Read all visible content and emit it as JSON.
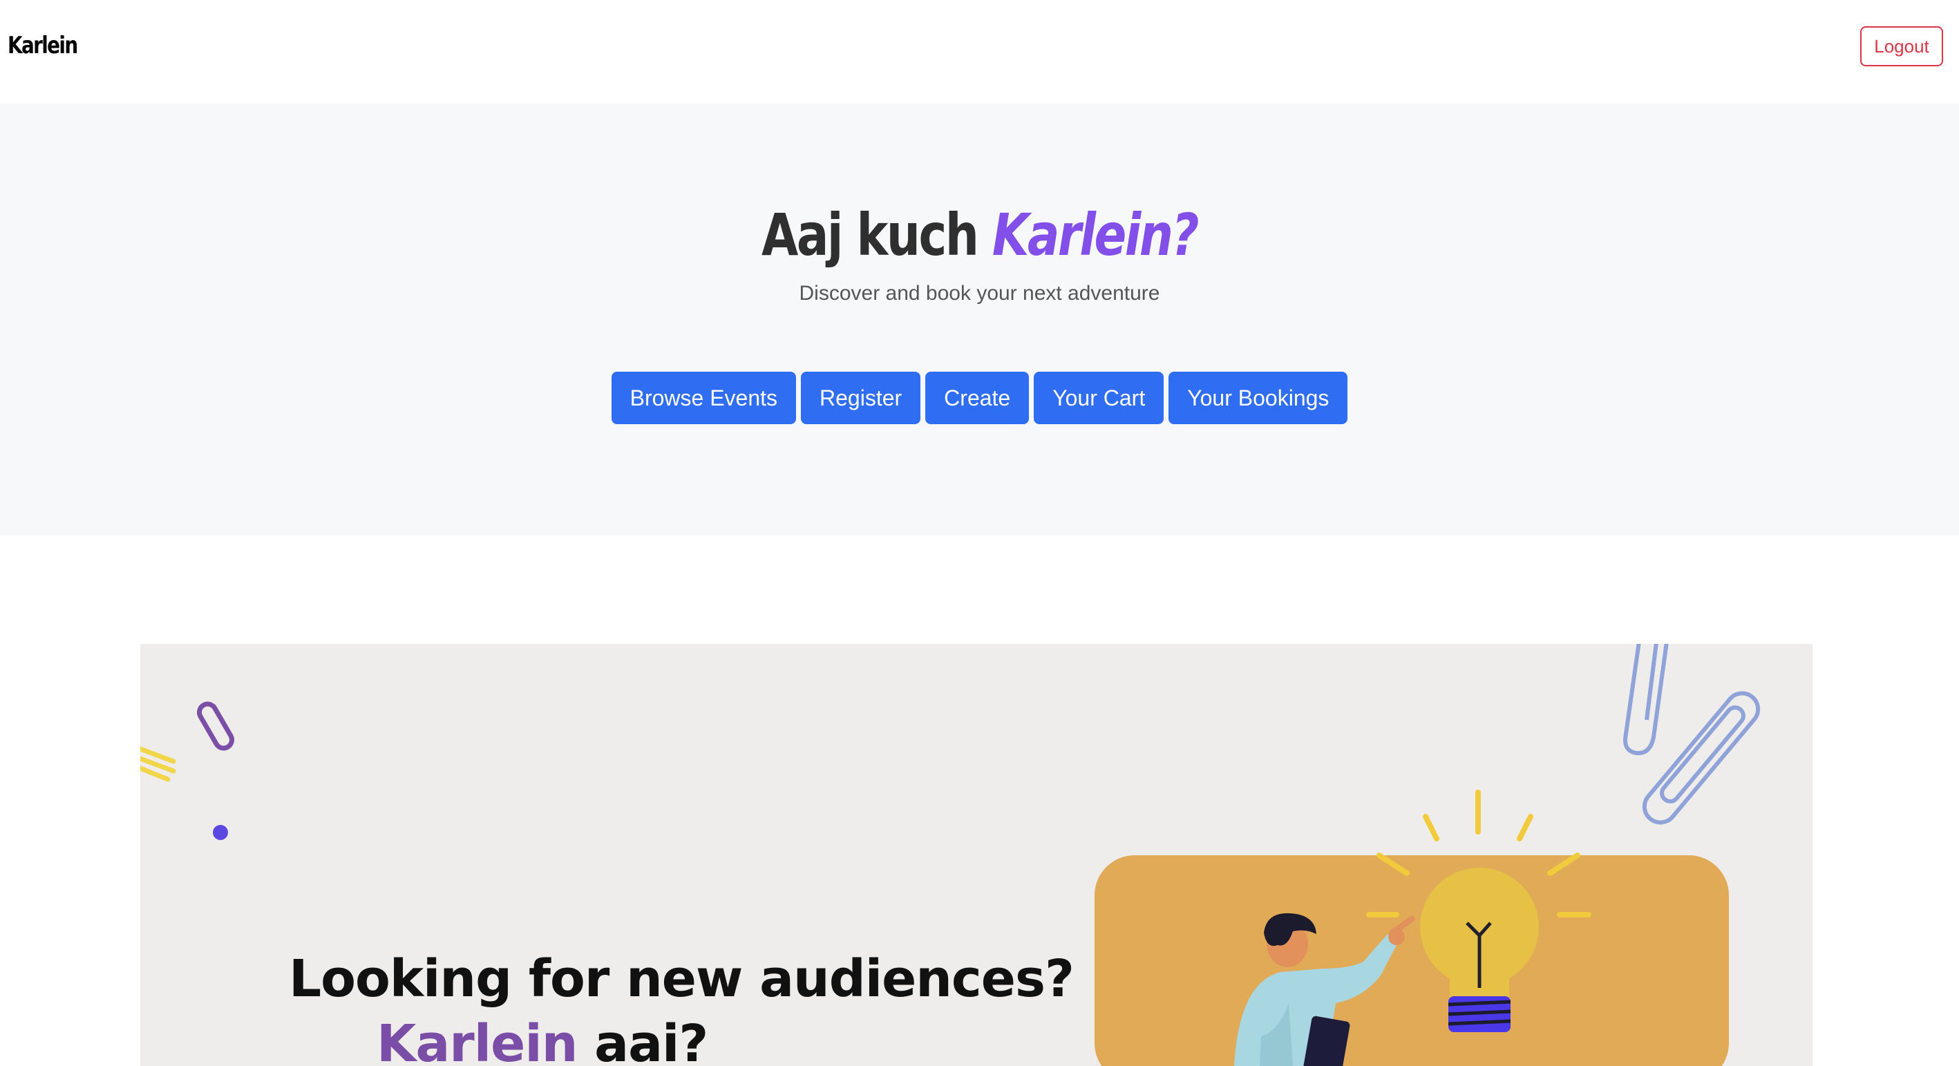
{
  "header": {
    "brand": "Karlein",
    "logout_label": "Logout"
  },
  "hero": {
    "title_prefix": "Aaj kuch",
    "title_accent": "Karlein?",
    "subtitle": "Discover and book your next adventure",
    "buttons": [
      {
        "label": "Browse Events"
      },
      {
        "label": "Register"
      },
      {
        "label": "Create"
      },
      {
        "label": "Your Cart"
      },
      {
        "label": "Your Bookings"
      }
    ]
  },
  "banner": {
    "headline": "Looking for new audiences?",
    "sub_accent": "Karlein",
    "sub_rest": "aai?",
    "illustration": "person-with-lightbulb"
  },
  "colors": {
    "primary_button": "#2f6df3",
    "accent_purple": "#8250e8",
    "logout_red": "#dc3545",
    "hero_background": "#f7f8fa",
    "banner_background": "#efedec",
    "illustration_panel": "#e0aa57"
  }
}
